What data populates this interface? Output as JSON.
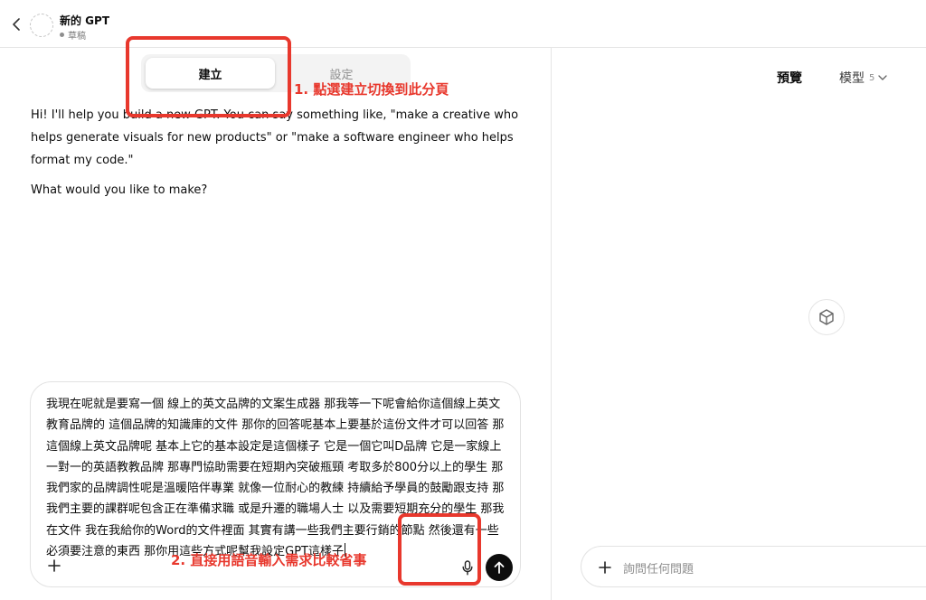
{
  "header": {
    "gpt_name": "新的 GPT",
    "status": "草稿"
  },
  "tabs": [
    {
      "label": "建立",
      "active": true
    },
    {
      "label": "設定",
      "active": false
    }
  ],
  "annotations": {
    "step1": "1. 點選建立切換到此分頁",
    "step2": "2. 直接用語音輸入需求比較省事",
    "color": "#e8382d"
  },
  "conversation": {
    "intro": "Hi! I'll help you build a new GPT. You can say something like, \"make a creative who helps generate visuals for new products\" or \"make a software engineer who helps format my code.\"",
    "question": "What would you like to make?"
  },
  "composer": {
    "text": "我現在呢就是要寫一個 線上的英文品牌的文案生成器 那我等一下呢會給你這個線上英文教育品牌的 這個品牌的知識庫的文件 那你的回答呢基本上要基於這份文件才可以回答 那這個線上英文品牌呢 基本上它的基本設定是這個樣子 它是一個它叫D品牌 它是一家線上一對一的英語教教品牌 那專門協助需要在短期內突破瓶頸 考取多於800分以上的學生 那我們家的品牌調性呢是溫暖陪伴專業 就像一位耐心的教練 持續給予學員的鼓勵跟支持 那我們主要的課群呢包含正在準備求職 或是升遷的職場人士 以及需要短期充分的學生 那我在文件 我在我給你的Word的文件裡面 其實有講一些我們主要行銷的節點 然後還有一些必須要注意的東西 那你用這些方式呢幫我設定GPT這樣子",
    "icons": [
      "plus-icon",
      "microphone-icon",
      "arrow-up-icon"
    ]
  },
  "preview": {
    "title": "預覽",
    "model_label": "模型",
    "model_version": "5",
    "placeholder": "詢問任何問題"
  }
}
